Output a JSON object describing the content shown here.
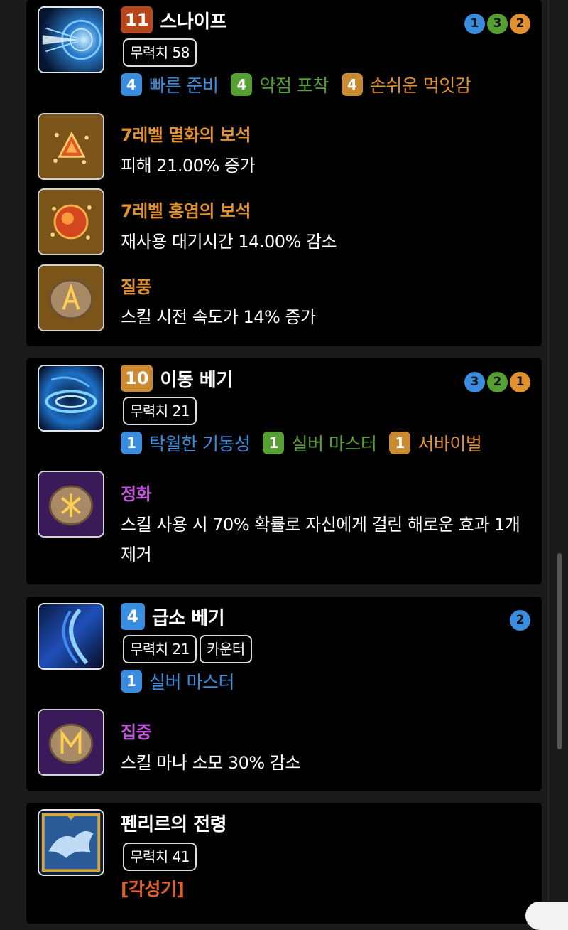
{
  "colors": {
    "blue": "#3a8dde",
    "green": "#56a033",
    "orange": "#c98a32",
    "dark_orange": "#b8461d",
    "blue_text": "#3a8dde",
    "green_text": "#56a033",
    "orange_text": "#e0902c",
    "purple_text": "#c253e0",
    "gem_bg": "#7a5418",
    "rune_legend_bg": "#7a5418",
    "rune_epic_bg": "#3b1a5a"
  },
  "skills": [
    {
      "level": "11",
      "name": "스나이프",
      "tags": [
        "무력치 58"
      ],
      "dots": [
        "1",
        "3",
        "2"
      ],
      "tripods": [
        {
          "level": "4",
          "name": "빠른 준비"
        },
        {
          "level": "4",
          "name": "약점 포착"
        },
        {
          "level": "4",
          "name": "손쉬운 먹잇감"
        }
      ],
      "gems": [
        {
          "title": "7레벨 멸화의 보석",
          "desc": "피해 21.00% 증가"
        },
        {
          "title": "7레벨 홍염의 보석",
          "desc": "재사용 대기시간 14.00% 감소"
        }
      ],
      "rune": {
        "title": "질풍",
        "desc": "스킬 시전 속도가 14% 증가"
      }
    },
    {
      "level": "10",
      "name": "이동 베기",
      "tags": [
        "무력치 21"
      ],
      "dots": [
        "3",
        "2",
        "1"
      ],
      "tripods": [
        {
          "level": "1",
          "name": "탁월한 기동성"
        },
        {
          "level": "1",
          "name": "실버 마스터"
        },
        {
          "level": "1",
          "name": "서바이벌"
        }
      ],
      "rune": {
        "title": "정화",
        "desc": "스킬 사용 시 70% 확률로 자신에게 걸린 해로운 효과 1개 제거"
      }
    },
    {
      "level": "4",
      "name": "급소 베기",
      "tags": [
        "무력치 21",
        "카운터"
      ],
      "dots": [
        "2"
      ],
      "tripods": [
        {
          "level": "1",
          "name": "실버 마스터"
        }
      ],
      "rune": {
        "title": "집중",
        "desc": "스킬 마나 소모 30% 감소"
      }
    },
    {
      "name": "펜리르의 전령",
      "tags": [
        "무력치 41"
      ],
      "awakening": "[각성기]"
    }
  ]
}
